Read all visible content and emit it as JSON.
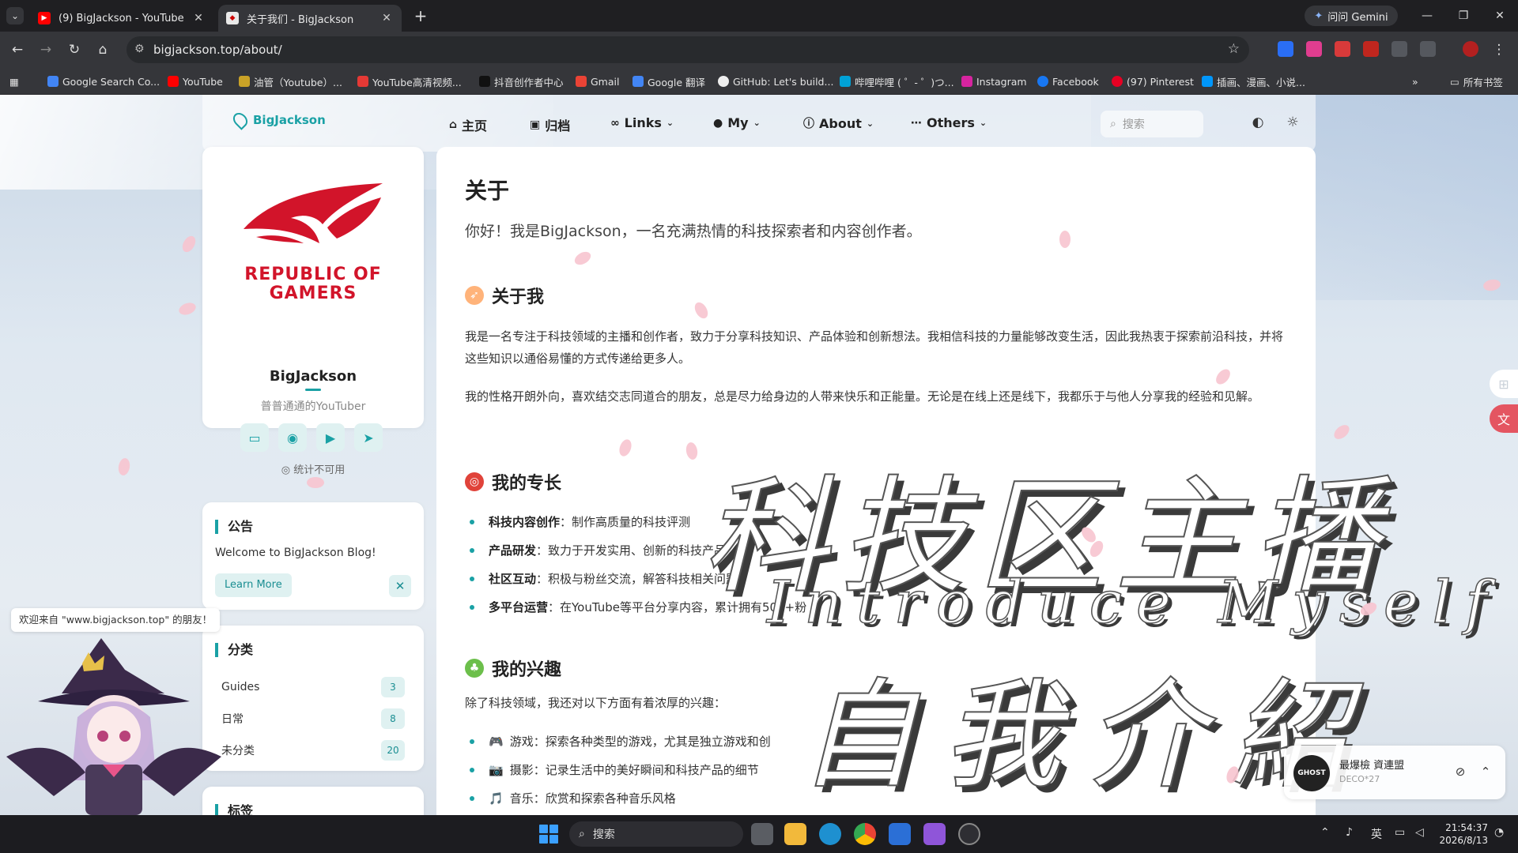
{
  "browser": {
    "tabs": [
      {
        "label": "(9) BigJackson - YouTube",
        "active": false
      },
      {
        "label": "关于我们 - BigJackson",
        "active": true
      }
    ],
    "gemini_label": "问问 Gemini",
    "url": "bigjackson.top/about/",
    "bookmarks": [
      {
        "label": "Google Search Co...",
        "color": "#4285f4"
      },
      {
        "label": "YouTube",
        "color": "#ff0000"
      },
      {
        "label": "油管（Youtube）...",
        "color": "#c9a227"
      },
      {
        "label": "YouTube高清视频...",
        "color": "#e53935"
      },
      {
        "label": "抖音创作者中心",
        "color": "#111111"
      },
      {
        "label": "Gmail",
        "color": "#ea4335"
      },
      {
        "label": "Google 翻译",
        "color": "#4285f4"
      },
      {
        "label": "GitHub: Let's build...",
        "color": "#eeeeee"
      },
      {
        "label": "哔哩哔哩 ( ゜- ゜)つ...",
        "color": "#00a1d6"
      },
      {
        "label": "Instagram",
        "color": "#d6249f"
      },
      {
        "label": "Facebook",
        "color": "#1877f2"
      },
      {
        "label": "(97) Pinterest",
        "color": "#e60023"
      },
      {
        "label": "插画、漫画、小说...",
        "color": "#0096fa"
      }
    ],
    "all_bookmarks": "所有书签"
  },
  "site": {
    "brand": "BigJackson",
    "nav": [
      {
        "label": "主页",
        "icon": "home-icon",
        "chevron": false
      },
      {
        "label": "归档",
        "icon": "archive-icon",
        "chevron": false
      },
      {
        "label": "Links",
        "icon": "link-icon",
        "chevron": true
      },
      {
        "label": "My",
        "icon": "user-icon",
        "chevron": true
      },
      {
        "label": "About",
        "icon": "info-icon",
        "chevron": true
      },
      {
        "label": "Others",
        "icon": "more-icon",
        "chevron": true
      }
    ],
    "search_placeholder": "搜索"
  },
  "profile": {
    "logo_text_1": "REPUBLIC OF",
    "logo_text_2": "GAMERS",
    "name": "BigJackson",
    "desc": "普普通通的YouTuber",
    "stats": "统计不可用"
  },
  "notice": {
    "title": "公告",
    "text": "Welcome to BigJackson Blog!",
    "button": "Learn More"
  },
  "categories": {
    "title": "分类",
    "items": [
      {
        "name": "Guides",
        "count": "3"
      },
      {
        "name": "日常",
        "count": "8"
      },
      {
        "name": "未分类",
        "count": "20"
      }
    ]
  },
  "tags": {
    "title": "标签"
  },
  "article": {
    "title": "关于",
    "lead": "你好！我是BigJackson，一名充满热情的科技探索者和内容创作者。",
    "sections": {
      "about": {
        "heading": "关于我",
        "p1": "我是一名专注于科技领域的主播和创作者，致力于分享科技知识、产品体验和创新想法。我相信科技的力量能够改变生活，因此我热衷于探索前沿科技，并将这些知识以通俗易懂的方式传递给更多人。",
        "p2": "我的性格开朗外向，喜欢结交志同道合的朋友，总是尽力给身边的人带来快乐和正能量。无论是在线上还是线下，我都乐于与他人分享我的经验和见解。"
      },
      "skills": {
        "heading": "我的专长",
        "items": [
          {
            "bold": "科技内容创作",
            "text": "：制作高质量的科技评测"
          },
          {
            "bold": "产品研发",
            "text": "：致力于开发实用、创新的科技产品"
          },
          {
            "bold": "社区互动",
            "text": "：积极与粉丝交流，解答科技相关问题"
          },
          {
            "bold": "多平台运营",
            "text": "：在YouTube等平台分享内容，累计拥有500+粉"
          }
        ]
      },
      "interests": {
        "heading": "我的兴趣",
        "intro": "除了科技领域，我还对以下方面有着浓厚的兴趣：",
        "items": [
          {
            "emoji": "🎮",
            "text": "游戏：探索各种类型的游戏，尤其是独立游戏和创"
          },
          {
            "emoji": "📷",
            "text": "摄影：记录生活中的美好瞬间和科技产品的细节"
          },
          {
            "emoji": "🎵",
            "text": "音乐：欣赏和探索各种音乐风格"
          }
        ]
      }
    }
  },
  "overlay": {
    "cn_top": "科技区主播",
    "en": "Introduce Myself",
    "cn_bottom": "自我介紹"
  },
  "welcome": "欢迎来自 \"www.bigjackson.top\" 的朋友！",
  "player": {
    "disc_label": "GHOST",
    "title": "最爆檢  資連盟",
    "artist": "DECO*27"
  },
  "taskbar": {
    "search": "搜索",
    "ime": "英",
    "time": "21:54:37",
    "date": "2026/8/13"
  },
  "colors": {
    "accent": "#1aa1a5",
    "rog_red": "#d2142a"
  }
}
